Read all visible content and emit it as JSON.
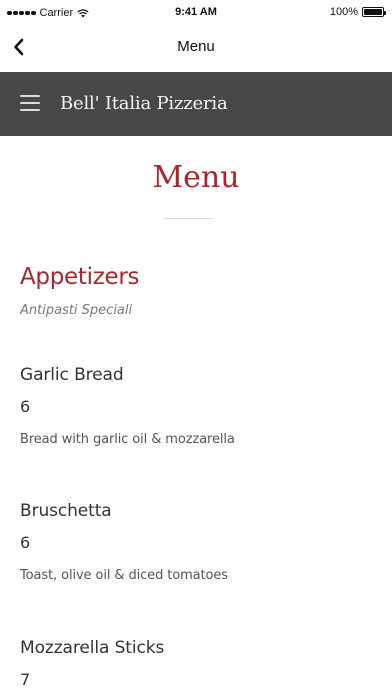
{
  "status_bar": {
    "carrier": "Carrier",
    "time": "9:41 AM",
    "battery": "100%"
  },
  "nav_bar": {
    "title": "Menu"
  },
  "site_header": {
    "title": "Bell' Italia Pizzeria"
  },
  "page": {
    "title": "Menu"
  },
  "section": {
    "heading": "Appetizers",
    "subheading": "Antipasti Speciali",
    "items": [
      {
        "name": "Garlic Bread",
        "price": "6",
        "description": "Bread with garlic oil & mozzarella"
      },
      {
        "name": "Bruschetta",
        "price": "6",
        "description": "Toast, olive oil & diced tomatoes"
      },
      {
        "name": "Mozzarella Sticks",
        "price": "7",
        "description": ""
      }
    ]
  }
}
